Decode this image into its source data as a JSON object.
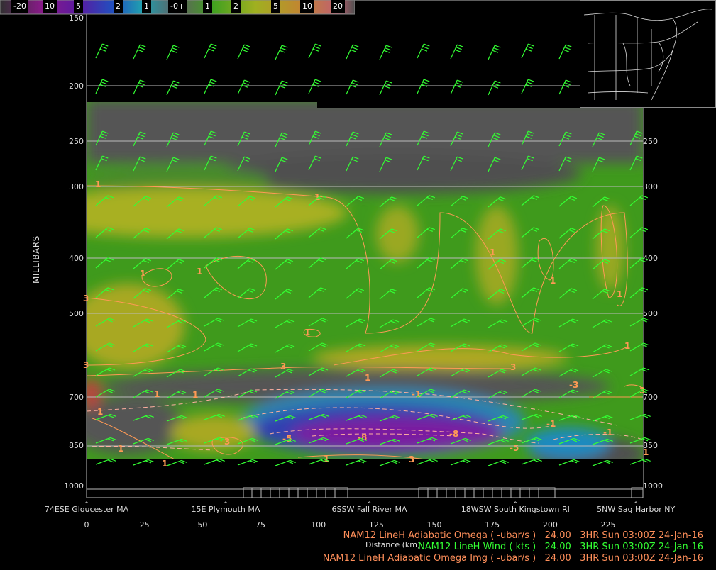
{
  "chart_data": {
    "type": "heatmap",
    "title": "",
    "ylabel": "MILLIBARS",
    "xlabel": "Distance (km)",
    "y_scale": "log-pressure",
    "ylim": [
      1000,
      150
    ],
    "xlim": [
      0,
      240
    ],
    "y_ticks": [
      "150",
      "200",
      "250",
      "300",
      "400",
      "500",
      "700",
      "850",
      "1000"
    ],
    "y_ticks_right": [
      "250",
      "300",
      "400",
      "500",
      "700",
      "850",
      "1000"
    ],
    "x_ticks": [
      "0",
      "25",
      "50",
      "75",
      "100",
      "125",
      "150",
      "175",
      "200",
      "225"
    ],
    "locations": [
      {
        "name": "74ESE Gloucester MA",
        "x": 0
      },
      {
        "name": "15E Plymouth MA",
        "x": 60
      },
      {
        "name": "6SSW Fall River MA",
        "x": 122
      },
      {
        "name": "18WSW South Kingstown RI",
        "x": 185
      },
      {
        "name": "5NW Sag Harbor NY",
        "x": 237
      }
    ],
    "colorbar": {
      "labels": [
        "-20",
        "10",
        "5",
        "2",
        "1",
        "-0+",
        "1",
        "2",
        "5",
        "10",
        "20"
      ],
      "colors": [
        "#3a3a3a",
        "#8a1a8a",
        "#5a1aa0",
        "#2040c0",
        "#20a0b0",
        "#606060",
        "#606060",
        "#40a020",
        "#a0b020",
        "#c09030",
        "#d06060",
        "#505050"
      ]
    },
    "contour_labels": [
      "1",
      "1",
      "1",
      "1",
      "1",
      "1",
      "1",
      "1",
      "1",
      "1",
      "1",
      "1",
      "1",
      "1",
      "1",
      "1",
      "3",
      "3",
      "3",
      "3",
      "3",
      "3",
      "3",
      "-1",
      "-1",
      "-3",
      "-3",
      "-5",
      "-5",
      "-8",
      "-8"
    ]
  },
  "legend": {
    "line1": "NAM12 LineH Adiabatic Omega ( -ubar/s )   24.00   3HR Sun 03:00Z 24-Jan-16",
    "line2": "NAM12 LineH Wind ( kts )   24.00   3HR Sun 03:00Z 24-Jan-16",
    "line3": "NAM12 LineH Adiabatic Omega Img ( -ubar/s )   24.00   3HR Sun 03:00Z 24-Jan-16"
  },
  "colors": {
    "wind": "#33ff33",
    "contour": "#ff9050",
    "grid": "#bbbbbb"
  }
}
